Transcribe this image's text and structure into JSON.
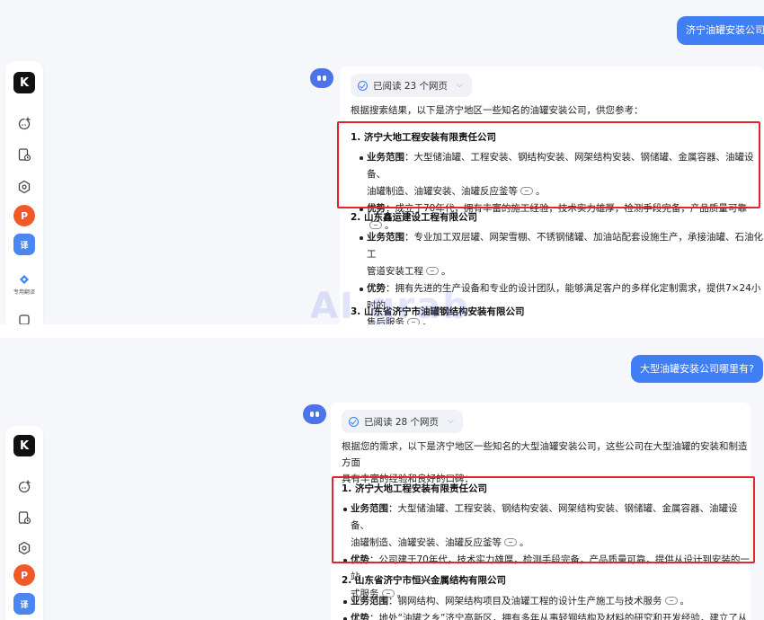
{
  "watermark": "AI grab",
  "panel1": {
    "user_message": "济宁油罐安装公司",
    "read_status": "已阅读 23 个网页",
    "intro": "根据搜索结果，以下是济宁地区一些知名的油罐安装公司，供您参考：",
    "companies": [
      {
        "name": "1. 济宁大地工程安装有限责任公司",
        "points": [
          {
            "label": "业务范围",
            "lines": [
              "：大型储油罐、工程安装、钢结构安装、网架结构安装、钢储罐、金属容器、油罐设备、",
              "油罐制造、油罐安装、油罐反应釜等"
            ]
          },
          {
            "label": "优势",
            "lines": [
              "：成立于70年代，拥有丰富的施工经验，技术实力雄厚，检测手段完备，产品质量可靠"
            ]
          }
        ]
      },
      {
        "name": "2. 山东鑫运建设工程有限公司",
        "points": [
          {
            "label": "业务范围",
            "lines": [
              "：专业加工双层罐、网架雪棚、不锈钢储罐、加油站配套设施生产，承接油罐、石油化工",
              "管道安装工程"
            ]
          },
          {
            "label": "优势",
            "lines": [
              "：拥有先进的生产设备和专业的设计团队，能够满足客户的多样化定制需求，提供7×24小时的",
              "售后服务"
            ]
          }
        ]
      },
      {
        "name": "3. 山东省济宁市油罐钢结构安装有限公司"
      }
    ],
    "sidebar_label": "专用翻译"
  },
  "panel2": {
    "user_message": "大型油罐安装公司哪里有?",
    "read_status": "已阅读 28 个网页",
    "intro_lines": [
      "根据您的需求，以下是济宁地区一些知名的大型油罐安装公司，这些公司在大型油罐的安装和制造方面",
      "具有丰富的经验和良好的口碑："
    ],
    "companies": [
      {
        "name": "1. 济宁大地工程安装有限责任公司",
        "points": [
          {
            "label": "业务范围",
            "lines": [
              "：大型储油罐、工程安装、钢结构安装、网架结构安装、钢储罐、金属容器、油罐设备、",
              "油罐制造、油罐安装、油罐反应釜等"
            ]
          },
          {
            "label": "优势",
            "lines": [
              "：公司建于70年代，技术实力雄厚，检测手段完备，产品质量可靠，提供从设计到安装的一站",
              "式服务"
            ]
          }
        ]
      },
      {
        "name": "2. 山东省济宁市恒兴金属结构有限公司",
        "points": [
          {
            "label": "业务范围",
            "lines": [
              "：钢网结构、网架结构项目及油罐工程的设计生产施工与技术服务"
            ]
          },
          {
            "label": "优势",
            "lines": [
              "：地处“油罐之乡”济宁高新区，拥有多年从事轻钢结构及材料的研究和开发经验，建立了从设"
            ]
          }
        ]
      }
    ]
  },
  "colors": {
    "accent": "#3f7ef5",
    "highlight": "#e1262b"
  }
}
